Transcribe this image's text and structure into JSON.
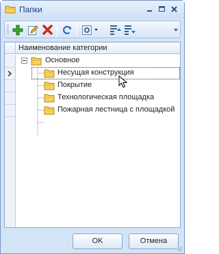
{
  "window": {
    "title": "Папки",
    "title_icon": "folder-icon",
    "controls": [
      "minimize-icon",
      "maximize-icon",
      "close-icon"
    ]
  },
  "toolbar": {
    "tools": [
      "add-icon",
      "edit-icon",
      "delete-icon",
      "refresh-icon",
      "settings-dropdown-icon",
      "expand-all-icon",
      "collapse-all-icon"
    ]
  },
  "grid": {
    "column_header": "Наименование категории",
    "tree": {
      "root": {
        "label": "Основное",
        "expanded": true
      },
      "children": [
        {
          "label": "Несущая конструкция",
          "focused": true
        },
        {
          "label": "Покрытие"
        },
        {
          "label": "Технологическая площадка"
        },
        {
          "label": "Пожарная лестница с площадкой"
        }
      ]
    }
  },
  "buttons": {
    "ok_label": "OK",
    "cancel_label": "Отмена"
  },
  "colors": {
    "frame": "#d4e4f7",
    "title_text": "#15428b",
    "folder": "#f5d15c"
  }
}
